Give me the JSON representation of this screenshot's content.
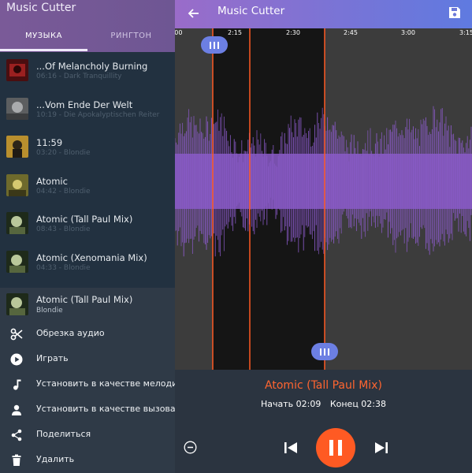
{
  "left_panel": {
    "title": "Music Cutter",
    "tabs": [
      {
        "label": "МУЗЫКА",
        "active": true
      },
      {
        "label": "РИНГТОН",
        "active": false
      }
    ],
    "songs": [
      {
        "title": "...Of Melancholy Burning",
        "subtitle": "06:16 - Dark Tranquillity",
        "thumb_color": "#7a1a1a"
      },
      {
        "title": "...Vom Ende Der Welt",
        "subtitle": "10:19 - Die Apokalyptischen Reiter",
        "thumb_color": "#6f7072"
      },
      {
        "title": "11:59",
        "subtitle": "03:20 - Blondie",
        "thumb_color": "#c9a13a"
      },
      {
        "title": "Atomic",
        "subtitle": "04:42 - Blondie",
        "thumb_color": "#8f8c3a"
      },
      {
        "title": "Atomic (Tall Paul Mix)",
        "subtitle": "08:43 - Blondie",
        "thumb_color": "#8fa06a"
      },
      {
        "title": "Atomic (Xenomania Mix)",
        "subtitle": "04:33 - Blondie",
        "thumb_color": "#8fa06a"
      }
    ],
    "context_song": {
      "title": "Atomic (Tall Paul Mix)",
      "subtitle": "Blondie",
      "thumb_color": "#8fa06a"
    },
    "menu": [
      {
        "label": "Обрезка аудио",
        "icon": "scissors-icon"
      },
      {
        "label": "Играть",
        "icon": "play-circle-icon"
      },
      {
        "label": "Установить в качестве мелодии п",
        "icon": "music-note-icon"
      },
      {
        "label": "Установить в качестве вызова для",
        "icon": "person-icon"
      },
      {
        "label": "Поделиться",
        "icon": "share-icon"
      },
      {
        "label": "Удалить",
        "icon": "trash-icon"
      }
    ]
  },
  "toolbar": {
    "title": "Music Cutter",
    "back_icon": "arrow-left-icon",
    "save_icon": "save-icon",
    "gradient_start": "#9a6cc9",
    "gradient_end": "#5f7ae0"
  },
  "timeline": {
    "ticks": [
      ":00",
      "2:15",
      "2:30",
      "2:45",
      "3:00",
      "3:15"
    ]
  },
  "waveform": {
    "wave_color": "#8a5ac8",
    "selection_color": "#ff5a23",
    "background": "#3c3c3c",
    "selected_background": "#151515"
  },
  "player": {
    "song_title": "Atomic (Tall Paul Mix)",
    "start_label": "Начать 02:09",
    "end_label": "Конец 02:38",
    "accent_color": "#ff5a23",
    "state": "playing"
  }
}
